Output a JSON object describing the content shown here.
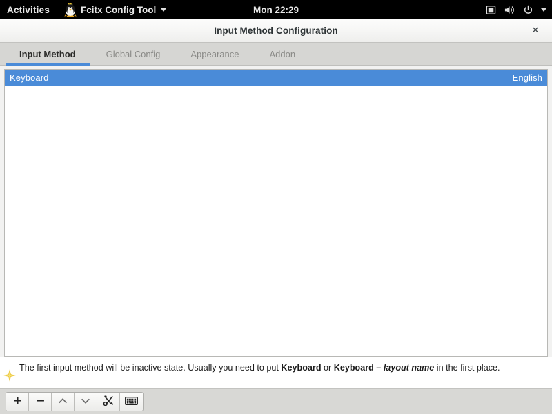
{
  "topbar": {
    "activities": "Activities",
    "app_menu": {
      "label": "Fcitx Config Tool",
      "icon": "fcitx-penguin-icon",
      "caret": "chevron-down-icon"
    },
    "clock": "Mon 22:29",
    "tray_icons": [
      "screen-icon",
      "volume-icon",
      "power-icon",
      "chevron-down-icon"
    ]
  },
  "window": {
    "title": "Input Method Configuration",
    "close_label": "✕"
  },
  "tabs": [
    {
      "label": "Input Method",
      "active": true
    },
    {
      "label": "Global Config",
      "active": false
    },
    {
      "label": "Appearance",
      "active": false
    },
    {
      "label": "Addon",
      "active": false
    }
  ],
  "input_methods": [
    {
      "name": "Keyboard",
      "language": "English",
      "selected": true
    }
  ],
  "hint": {
    "icon": "sparkle-icon",
    "text_part1": "The first input method will be inactive state. Usually you need to put ",
    "bold1": "Keyboard",
    "text_part2": " or ",
    "bold2": "Keyboard – ",
    "bold_italic": "layout name",
    "text_part3": " in the first place."
  },
  "toolbar": {
    "buttons": [
      {
        "name": "add-input-method-button",
        "glyph": "＋",
        "icon": "plus-icon"
      },
      {
        "name": "remove-input-method-button",
        "glyph": "−",
        "icon": "minus-icon"
      },
      {
        "name": "move-up-button",
        "glyph": "⌃",
        "icon": "chevron-up-icon"
      },
      {
        "name": "move-down-button",
        "glyph": "⌄",
        "icon": "chevron-down-icon"
      },
      {
        "name": "configure-button",
        "glyph": "",
        "icon": "tools-icon"
      },
      {
        "name": "keyboard-layout-button",
        "glyph": "",
        "icon": "keyboard-icon"
      }
    ]
  },
  "colors": {
    "accent_blue": "#4a8bd8",
    "topbar_bg": "#000000",
    "tabbar_bg": "#d6d6d3",
    "toolbar_bg": "#d8d8d5",
    "hint_icon": "#e9c83c"
  }
}
